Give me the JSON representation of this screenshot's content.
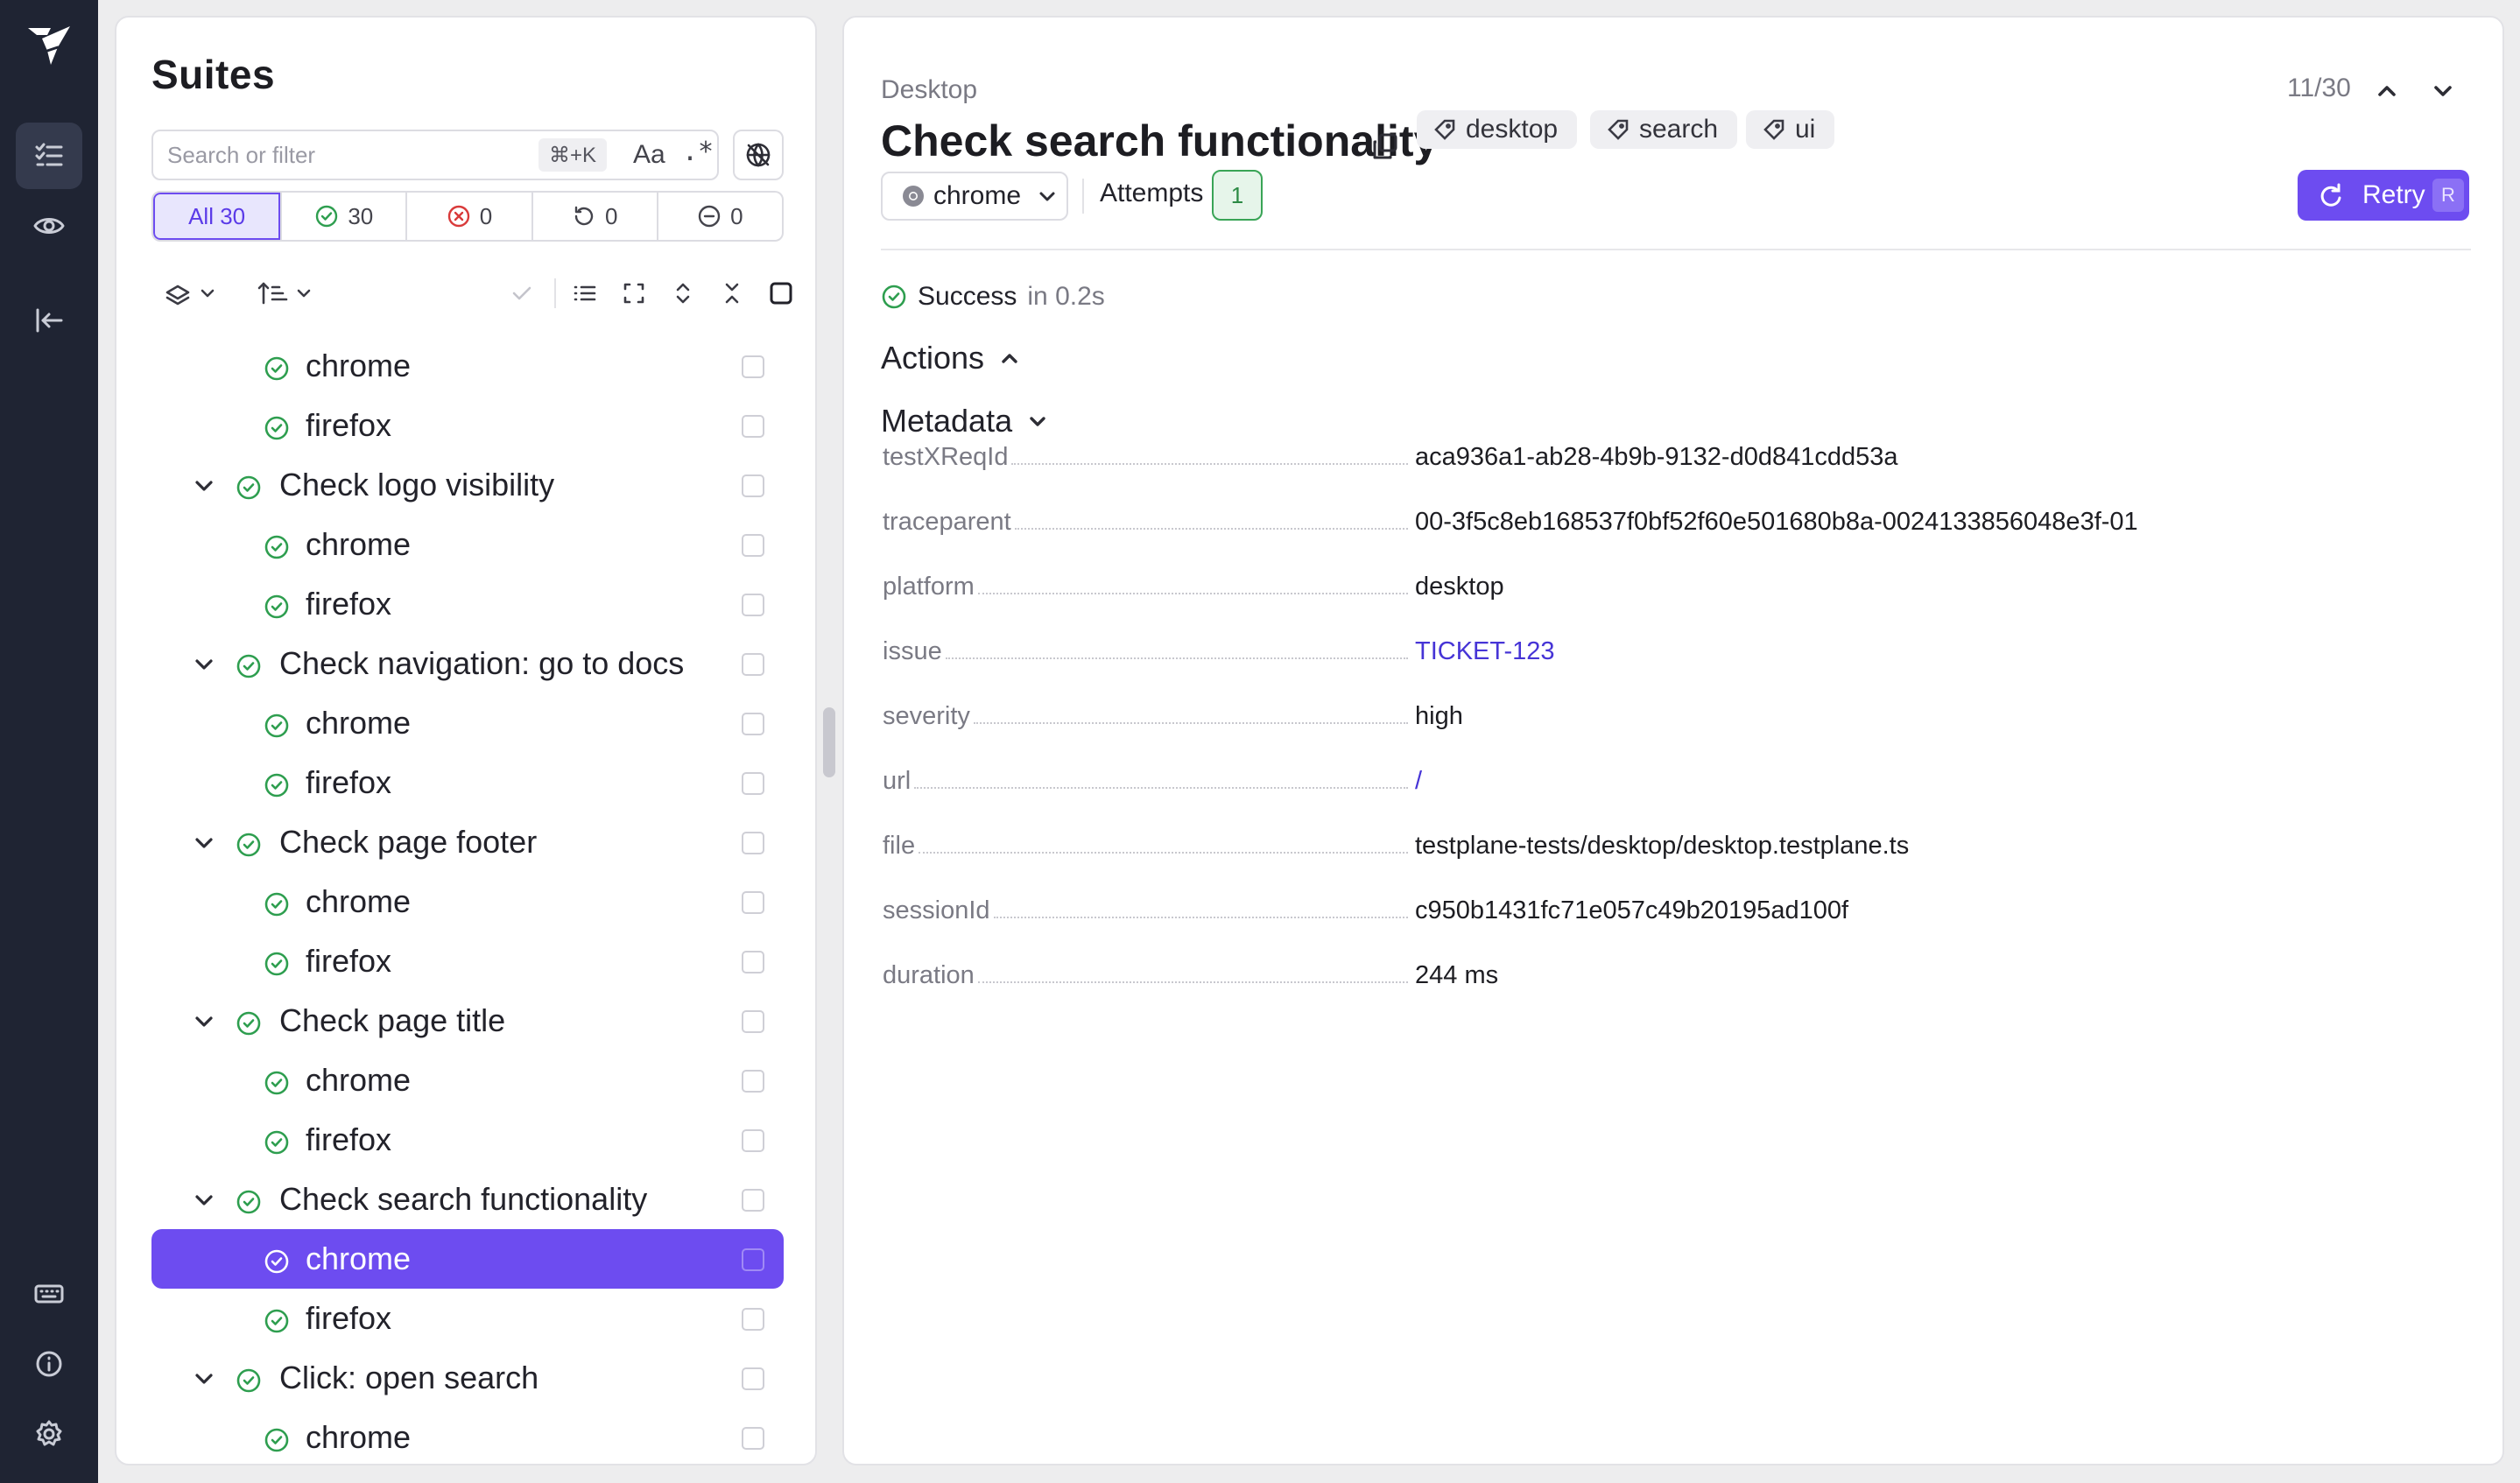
{
  "rail": {
    "items": [
      "logo",
      "suites",
      "visual-checks",
      "collapse"
    ],
    "bottom": [
      "keyboard",
      "info",
      "settings"
    ]
  },
  "suites": {
    "title": "Suites",
    "search_placeholder": "Search or filter",
    "shortcut": "⌘+K",
    "match_case": "Aa",
    "regex": ".*",
    "filters": [
      {
        "label": "All 30",
        "icon": ""
      },
      {
        "label": "30",
        "icon": "check-circle-icon"
      },
      {
        "label": "0",
        "icon": "x-circle-icon"
      },
      {
        "label": "0",
        "icon": "retry-icon"
      },
      {
        "label": "0",
        "icon": "minus-circle-icon"
      }
    ],
    "tree": [
      {
        "label": "chrome",
        "level": 2
      },
      {
        "label": "firefox",
        "level": 2
      },
      {
        "label": "Check logo visibility",
        "level": 1
      },
      {
        "label": "chrome",
        "level": 2
      },
      {
        "label": "firefox",
        "level": 2
      },
      {
        "label": "Check navigation: go to docs",
        "level": 1
      },
      {
        "label": "chrome",
        "level": 2
      },
      {
        "label": "firefox",
        "level": 2
      },
      {
        "label": "Check page footer",
        "level": 1
      },
      {
        "label": "chrome",
        "level": 2
      },
      {
        "label": "firefox",
        "level": 2
      },
      {
        "label": "Check page title",
        "level": 1
      },
      {
        "label": "chrome",
        "level": 2
      },
      {
        "label": "firefox",
        "level": 2
      },
      {
        "label": "Check search functionality",
        "level": 1
      },
      {
        "label": "chrome",
        "level": 2,
        "selected": true
      },
      {
        "label": "firefox",
        "level": 2
      },
      {
        "label": "Click: open search",
        "level": 1
      },
      {
        "label": "chrome",
        "level": 2
      }
    ]
  },
  "detail": {
    "breadcrumb": "Desktop",
    "counter": "11/30",
    "title": "Check search functionality",
    "tags": [
      "desktop",
      "search",
      "ui"
    ],
    "browser": "chrome",
    "attempts_label": "Attempts",
    "attempt": "1",
    "retry_label": "Retry",
    "retry_key": "R",
    "status": "Success",
    "status_duration": "in 0.2s",
    "actions_label": "Actions",
    "metadata_label": "Metadata",
    "metadata": [
      {
        "key": "testXReqId",
        "value": "aca936a1-ab28-4b9b-9132-d0d841cdd53a"
      },
      {
        "key": "traceparent",
        "value": "00-3f5c8eb168537f0bf52f60e501680b8a-0024133856048e3f-01"
      },
      {
        "key": "platform",
        "value": "desktop"
      },
      {
        "key": "issue",
        "value": "TICKET-123",
        "link": true
      },
      {
        "key": "severity",
        "value": "high"
      },
      {
        "key": "url",
        "value": "/",
        "link": true
      },
      {
        "key": "file",
        "value": "testplane-tests/desktop/desktop.testplane.ts"
      },
      {
        "key": "sessionId",
        "value": "c950b1431fc71e057c49b20195ad100f"
      },
      {
        "key": "duration",
        "value": "244 ms"
      }
    ]
  },
  "colors": {
    "accent": "#6d4cf0",
    "success": "#2e9e4f",
    "rail": "#1f2433",
    "link": "#4634d6"
  }
}
